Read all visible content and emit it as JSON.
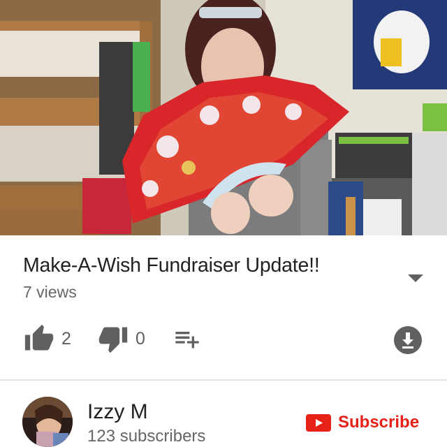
{
  "video": {
    "title": "Make-A-Wish Fundraiser Update!!",
    "views": "7 views"
  },
  "actions": {
    "likes": "2",
    "dislikes": "0"
  },
  "channel": {
    "name": "Izzy M",
    "subscribers": "123 subscribers"
  },
  "subscribe": {
    "label": "Subscribe",
    "color": "#e62117"
  },
  "icons": {
    "like": "thumbs-up-icon",
    "dislike": "thumbs-down-icon",
    "add_to_playlist": "playlist-add-icon",
    "download": "download-icon",
    "expand": "caret-down-icon",
    "subscribe": "youtube-logo-icon"
  },
  "colors": {
    "icon": "#606060",
    "subscribe_text": "#e62117",
    "subscribe_icon": "#e62117"
  }
}
